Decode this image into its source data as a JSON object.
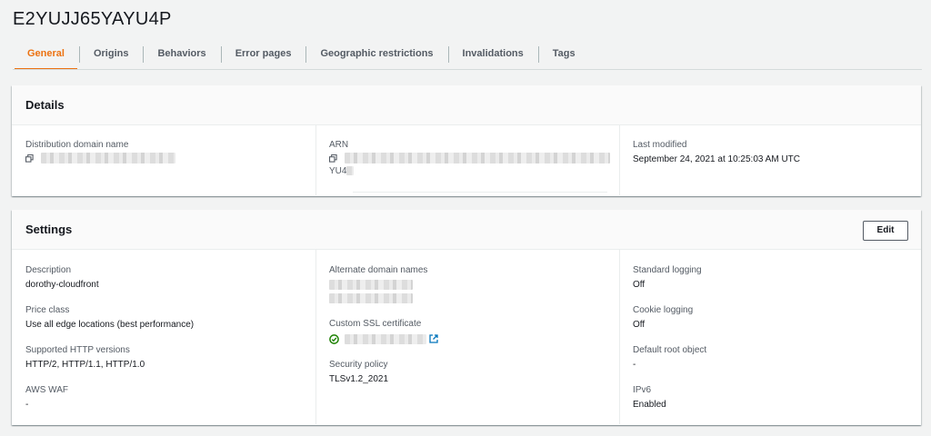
{
  "distribution_id": "E2YUJJ65YAYU4P",
  "tabs": [
    "General",
    "Origins",
    "Behaviors",
    "Error pages",
    "Geographic restrictions",
    "Invalidations",
    "Tags"
  ],
  "active_tab": "General",
  "details": {
    "title": "Details",
    "distribution_domain_label": "Distribution domain name",
    "arn_label": "ARN",
    "arn_suffix": "YU4",
    "last_modified_label": "Last modified",
    "last_modified_value": "September 24, 2021 at 10:25:03 AM UTC"
  },
  "settings": {
    "title": "Settings",
    "edit_label": "Edit",
    "description_label": "Description",
    "description_value": "dorothy-cloudfront",
    "price_class_label": "Price class",
    "price_class_value": "Use all edge locations (best performance)",
    "http_versions_label": "Supported HTTP versions",
    "http_versions_value": "HTTP/2, HTTP/1.1, HTTP/1.0",
    "aws_waf_label": "AWS WAF",
    "aws_waf_value": "-",
    "alternate_domains_label": "Alternate domain names",
    "ssl_cert_label": "Custom SSL certificate",
    "security_policy_label": "Security policy",
    "security_policy_value": "TLSv1.2_2021",
    "standard_logging_label": "Standard logging",
    "standard_logging_value": "Off",
    "cookie_logging_label": "Cookie logging",
    "cookie_logging_value": "Off",
    "default_root_label": "Default root object",
    "default_root_value": "-",
    "ipv6_label": "IPv6",
    "ipv6_value": "Enabled"
  },
  "colors": {
    "accent": "#ec7211",
    "success": "#1d8102",
    "link": "#0073bb"
  },
  "icons": [
    "copy-icon",
    "check-circle-icon",
    "external-link-icon"
  ]
}
